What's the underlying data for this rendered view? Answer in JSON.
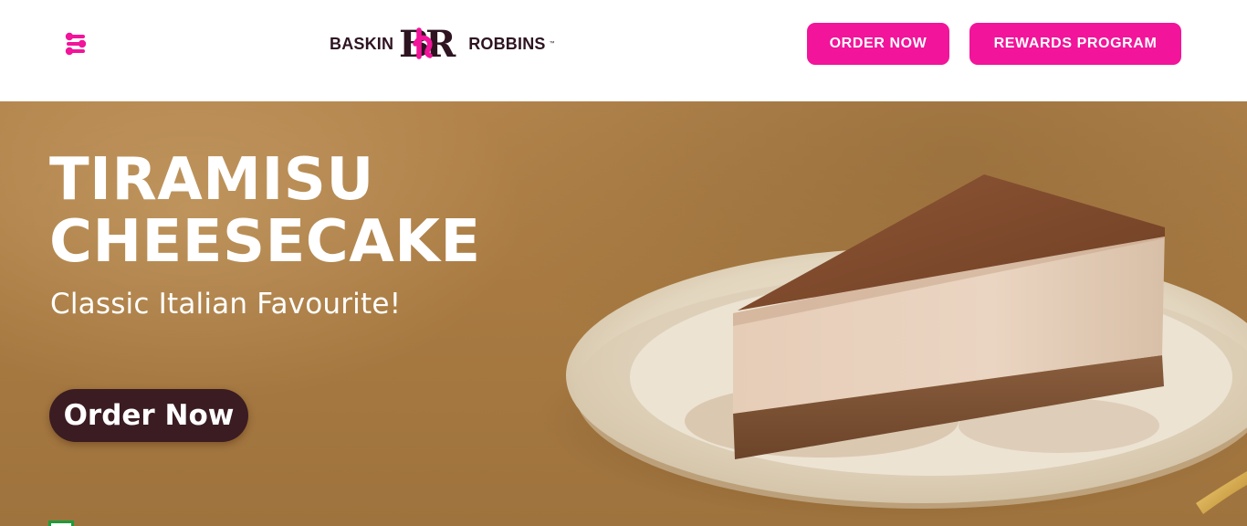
{
  "header": {
    "menu_icon": "menu-sliders-icon",
    "logo": {
      "left_text": "BASKIN",
      "monogram": "BR",
      "right_text": "ROBBINS",
      "trademark": "™"
    },
    "order_now_label": "ORDER NOW",
    "rewards_label": "REWARDS PROGRAM",
    "accent_color": "#f2149a",
    "brand_dark": "#2e1421"
  },
  "hero": {
    "title": "TIRAMISU\nCHEESECAKE",
    "subtitle": "Classic Italian Favourite!",
    "cta_label": "Order Now",
    "cta_color": "#3a1c22",
    "indicator_icon": "veg-symbol-icon"
  }
}
